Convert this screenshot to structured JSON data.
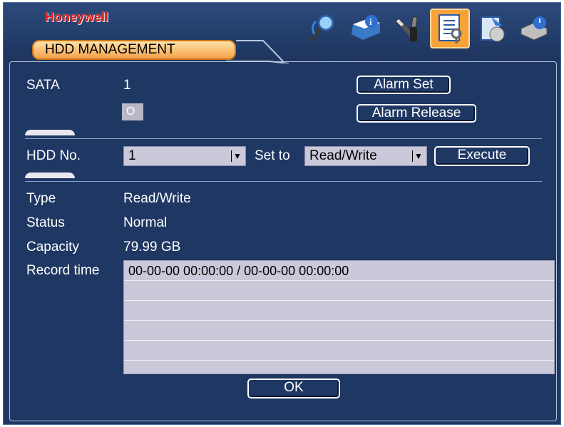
{
  "brand": "Honeywell",
  "window_title": "HDD MANAGEMENT",
  "toolbar": {
    "icons": [
      "search-icon",
      "info-icon",
      "tools-icon",
      "management-icon",
      "backup-icon",
      "shutdown-icon"
    ],
    "active": "management-icon"
  },
  "sata": {
    "label": "SATA",
    "value": "1",
    "status_glyph": "O"
  },
  "buttons": {
    "alarm_set": "Alarm Set",
    "alarm_release": "Alarm Release",
    "execute": "Execute",
    "ok": "OK"
  },
  "hdd": {
    "label": "HDD No.",
    "value": "1",
    "set_to_label": "Set to",
    "set_to_value": "Read/Write"
  },
  "info": {
    "type_label": "Type",
    "type_value": "Read/Write",
    "status_label": "Status",
    "status_value": "Normal",
    "capacity_label": "Capacity",
    "capacity_value": "79.99 GB",
    "record_time_label": "Record time"
  },
  "record_times": [
    "00-00-00 00:00:00 / 00-00-00 00:00:00",
    "",
    "",
    "",
    "",
    ""
  ],
  "colors": {
    "background": "#1f3763",
    "accent": "#f4a24a",
    "brand": "#d81818"
  }
}
